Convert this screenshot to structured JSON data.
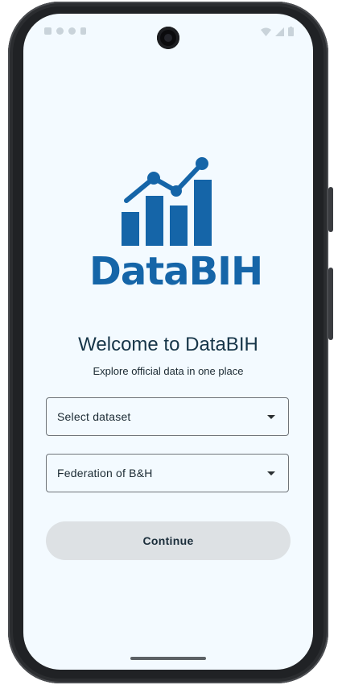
{
  "status_bar": {
    "icons_left": [
      "notification-icon",
      "shield-icon",
      "settings-icon",
      "sim-icon"
    ],
    "icons_right": [
      "wifi-icon",
      "signal-icon",
      "battery-icon"
    ]
  },
  "logo": {
    "text": "DataBIH",
    "brand_color": "#1565a8"
  },
  "welcome": {
    "title": "Welcome to DataBIH",
    "subtitle": "Explore official data in one place"
  },
  "dataset_select": {
    "value": "Select dataset"
  },
  "entity_select": {
    "value": "Federation of B&H"
  },
  "continue_button": {
    "label": "Continue",
    "enabled": false
  },
  "colors": {
    "background": "#f3faff",
    "title": "#163548",
    "button_disabled": "#dde1e4"
  }
}
